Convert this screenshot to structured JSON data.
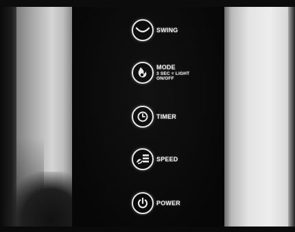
{
  "controls": {
    "swing": {
      "label": "SWING",
      "icon": "swing-wave-icon"
    },
    "mode": {
      "label": "MODE",
      "sub_line1": "3 SEC = LIGHT",
      "sub_line2": "ON/OFF",
      "icon": "mode-flame-icon"
    },
    "timer": {
      "label": "TIMER",
      "icon": "timer-clock-icon"
    },
    "speed": {
      "label": "SPEED",
      "icon": "speed-fan-icon"
    },
    "power": {
      "label": "POWER",
      "icon": "power-icon"
    }
  },
  "colors": {
    "panel": "#0b0b0b",
    "icon_and_text": "#e9e9e9"
  }
}
